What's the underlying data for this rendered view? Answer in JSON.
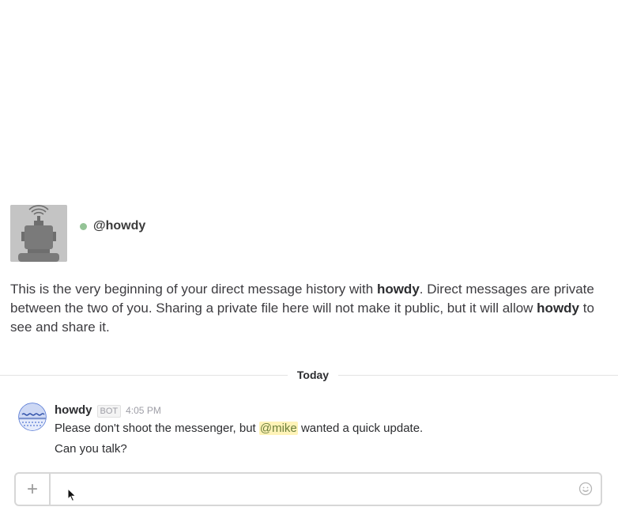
{
  "intro": {
    "handle": "@howdy",
    "presence": "online",
    "text_pre": "This is the very beginning of your direct message history with ",
    "bot_name_1": "howdy",
    "text_mid": ". Direct messages are private between the two of you. Sharing a private file here will not make it public, but it will allow ",
    "bot_name_2": "howdy",
    "text_post": " to see and share it."
  },
  "divider": {
    "label": "Today"
  },
  "message": {
    "author": "howdy",
    "badge": "BOT",
    "time": "4:05 PM",
    "line1_pre": "Please don't shoot the messenger, but ",
    "line1_mention": "@mike",
    "line1_post": " wanted a quick update.",
    "line2": "Can you talk?"
  },
  "composer": {
    "add_label": "+",
    "value": "",
    "add_icon": "plus-icon",
    "emoji_icon": "smiley-icon"
  },
  "colors": {
    "presence": "#94c396",
    "mention_bg": "#fff3b8",
    "avatar_blue": "#4a6fd1"
  }
}
